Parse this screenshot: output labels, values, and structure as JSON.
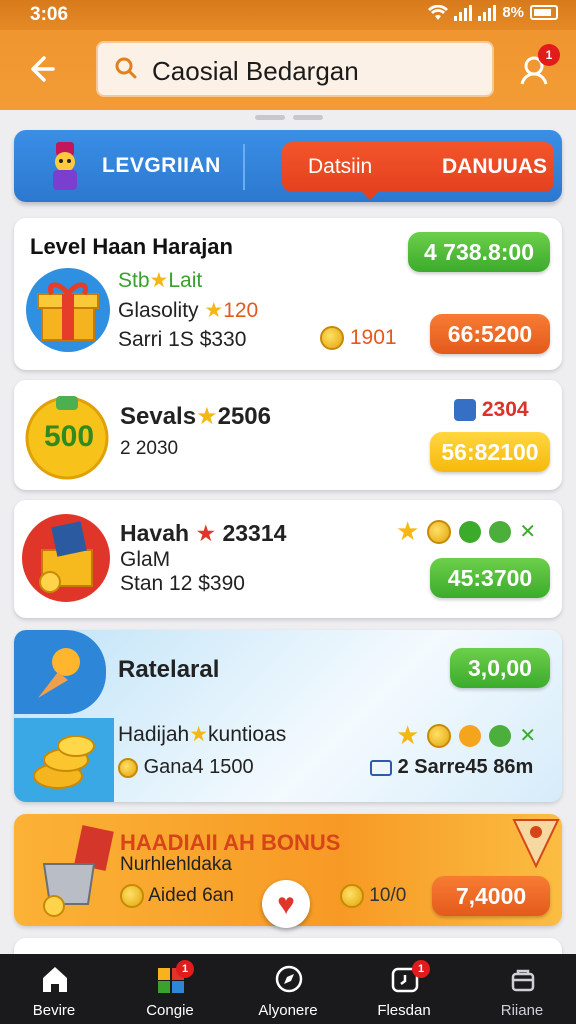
{
  "status_bar": {
    "time": "3:06",
    "battery": "8%"
  },
  "header": {
    "search_text": "Caosial Bedargan",
    "notif_count": "1"
  },
  "tabs": {
    "left_label": "LEVGRIIAN",
    "right_label_1": "Datsiin",
    "right_label_2": "DANUUAS"
  },
  "card1": {
    "title": "Level Haan Harajan",
    "line1": "Stb",
    "line1b": "Lait",
    "line2": "Glasolity",
    "line2b": "120",
    "line3": "Sarri 1S $330",
    "coin_value": "1901",
    "badge_green": "4 738.8:00",
    "badge_orange": "66:5200"
  },
  "card2": {
    "title": "Sevals",
    "title_num": "2506",
    "line2": "2 2030",
    "right_val": "2304",
    "badge_yellow": "56:82100",
    "icon_text": "500"
  },
  "card3": {
    "title": "Havah",
    "title_num": "23314",
    "line2": "GlaM",
    "line3": "Stan 12 $390",
    "badge_green": "45:3700"
  },
  "card4": {
    "title": "Ratelaral",
    "badge_green": "3,0,00",
    "line2": "Hadijah",
    "line2b": "kuntioas",
    "line3": "Gana4 1500",
    "right_text": "2 Sarre45 86m"
  },
  "card5": {
    "title": "HAADIAII AH BONUS",
    "subtitle": "Nurhlehldaka",
    "line": "Aided 6an",
    "coin_value": "10/0",
    "badge_orange": "7,4000"
  },
  "nav": [
    {
      "label": "Bevire"
    },
    {
      "label": "Congie",
      "badge": "1"
    },
    {
      "label": "Alyonere"
    },
    {
      "label": "Flesdan",
      "badge": "1"
    },
    {
      "label": "Riiane"
    }
  ],
  "colors": {
    "header": "#f39c36",
    "tab_blue": "#2c78cf",
    "tab_red": "#e4411f",
    "green": "#3cab2c",
    "orange": "#e45a1c",
    "yellow": "#f6b90c"
  }
}
